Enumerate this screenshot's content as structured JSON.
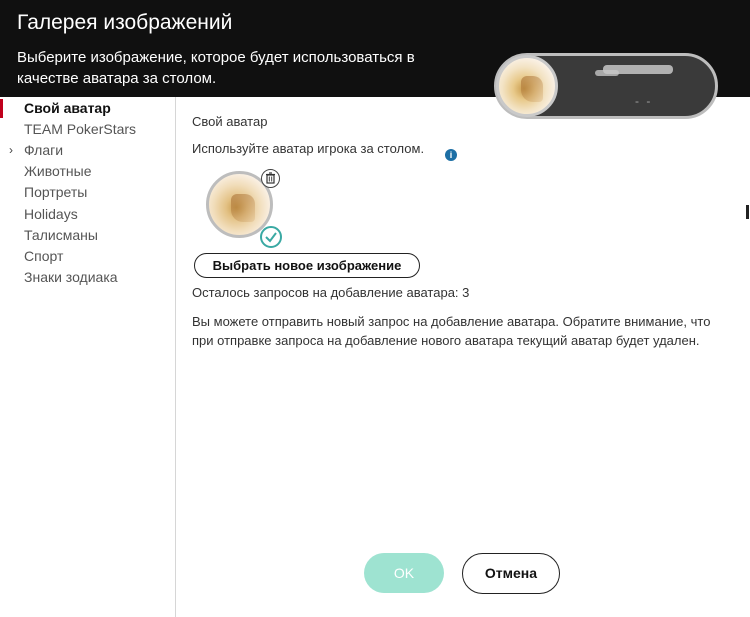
{
  "window": {
    "title": "Галерея изображений",
    "subtitle": "Выберите изображение, которое будет использоваться в качестве аватара за столом."
  },
  "preview": {
    "sub": "- -"
  },
  "sidebar": {
    "items": [
      {
        "label": "Свой аватар",
        "active": true
      },
      {
        "label": "TEAM PokerStars"
      },
      {
        "label": "Флаги",
        "chevron": "›"
      },
      {
        "label": "Животные"
      },
      {
        "label": "Портреты"
      },
      {
        "label": "Holidays"
      },
      {
        "label": "Талисманы"
      },
      {
        "label": "Спорт"
      },
      {
        "label": "Знаки зодиака"
      }
    ]
  },
  "content": {
    "section_title": "Свой аватар",
    "use_label": "Используйте аватар игрока за столом.",
    "info_icon": "i",
    "select_button": "Выбрать новое изображение",
    "requests_text": "Осталось запросов на добавление аватара:  3",
    "note": "Вы можете отправить новый запрос на добавление аватара. Обратите внимание, что при отправке запроса на добавление нового аватара текущий аватар будет удален."
  },
  "footer": {
    "ok_label": "OK",
    "cancel_label": "Отмена"
  },
  "colors": {
    "accent_red": "#c0001c",
    "ok_disabled": "#9ee3d1",
    "check_teal": "#3aa9a3",
    "info_blue": "#1d6fa5"
  },
  "icons": {
    "trash": "trash-icon",
    "check": "check-icon",
    "info": "info-icon",
    "chevron": "chevron-right-icon"
  }
}
